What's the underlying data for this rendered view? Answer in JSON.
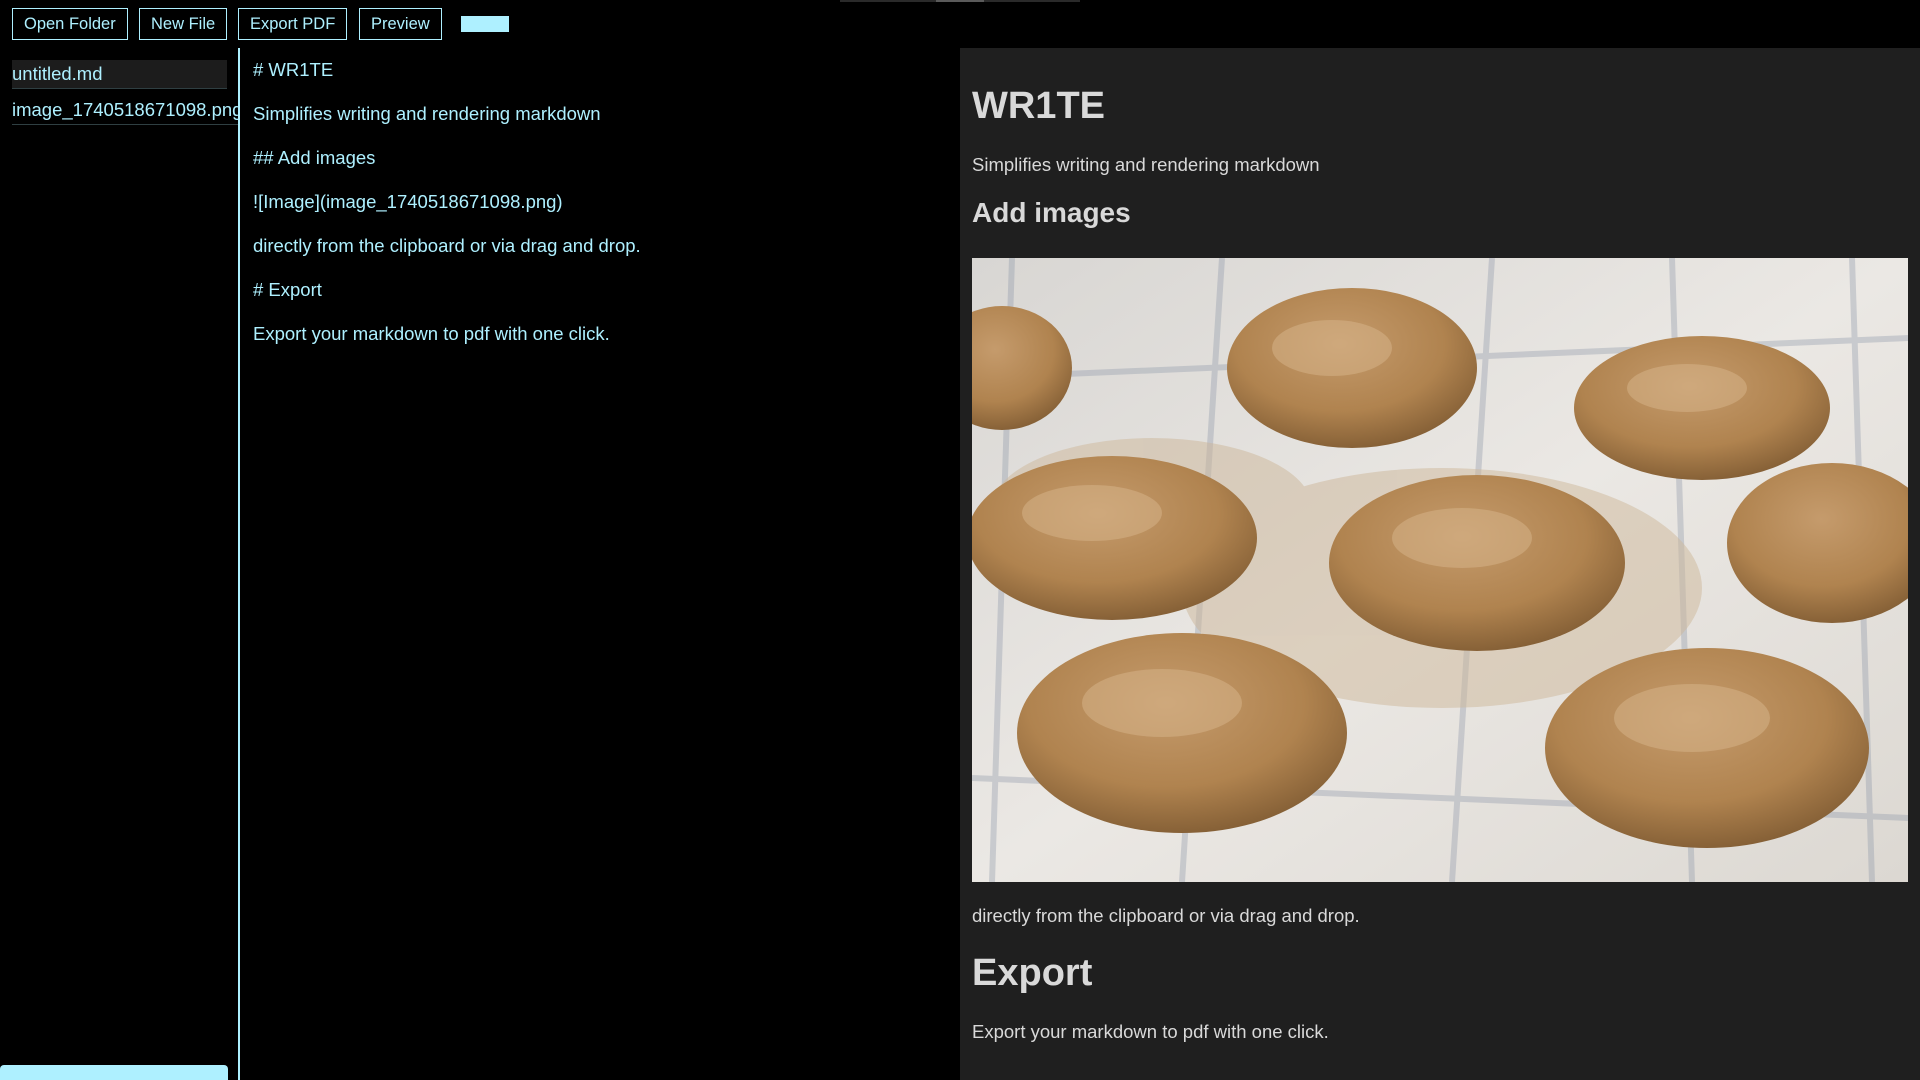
{
  "toolbar": {
    "open_folder": "Open Folder",
    "new_file": "New File",
    "export_pdf": "Export PDF",
    "preview": "Preview",
    "theme_color": "#aef0ff"
  },
  "sidebar": {
    "files": [
      {
        "name": "untitled.md",
        "active": true
      },
      {
        "name": "image_1740518671098.png",
        "active": false
      }
    ]
  },
  "editor": {
    "lines": [
      "# WR1TE",
      "Simplifies writing and rendering markdown",
      "## Add images",
      "![Image](image_1740518671098.png)",
      "directly from the clipboard or via drag and drop.",
      "# Export",
      "Export your markdown to pdf with one click."
    ]
  },
  "preview": {
    "title": "WR1TE",
    "intro": "Simplifies writing and rendering markdown",
    "add_images_heading": "Add images",
    "image_alt": "Image",
    "image_caption_text": "directly from the clipboard or via drag and drop.",
    "export_heading": "Export",
    "export_text": "Export your markdown to pdf with one click."
  },
  "colors": {
    "accent": "#aef0ff",
    "app_background": "#000000",
    "preview_background": "#1f1f1f",
    "preview_text": "#d9d9d9"
  }
}
